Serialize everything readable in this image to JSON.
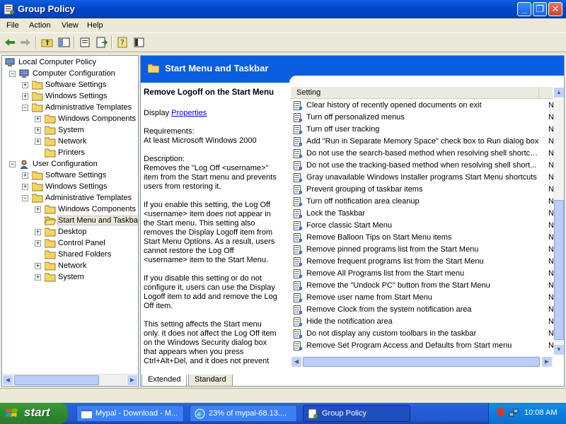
{
  "window": {
    "title": "Group Policy",
    "buttons": {
      "minimize": "_",
      "maximize": "❐",
      "close": "✕"
    }
  },
  "menubar": [
    "File",
    "Action",
    "View",
    "Help"
  ],
  "tree": {
    "items": [
      {
        "label": "Local Computer Policy",
        "indent": 0,
        "expander": "",
        "icon": "computer-policy-icon"
      },
      {
        "label": "Computer Configuration",
        "indent": 1,
        "expander": "−",
        "icon": "computer-icon"
      },
      {
        "label": "Software Settings",
        "indent": 2,
        "expander": "+",
        "icon": "folder-icon"
      },
      {
        "label": "Windows Settings",
        "indent": 2,
        "expander": "+",
        "icon": "folder-icon"
      },
      {
        "label": "Administrative Templates",
        "indent": 2,
        "expander": "−",
        "icon": "folder-icon"
      },
      {
        "label": "Windows Components",
        "indent": 3,
        "expander": "+",
        "icon": "folder-icon"
      },
      {
        "label": "System",
        "indent": 3,
        "expander": "+",
        "icon": "folder-icon"
      },
      {
        "label": "Network",
        "indent": 3,
        "expander": "+",
        "icon": "folder-icon"
      },
      {
        "label": "Printers",
        "indent": 3,
        "expander": "",
        "icon": "folder-icon"
      },
      {
        "label": "User Configuration",
        "indent": 1,
        "expander": "−",
        "icon": "user-icon"
      },
      {
        "label": "Software Settings",
        "indent": 2,
        "expander": "+",
        "icon": "folder-icon"
      },
      {
        "label": "Windows Settings",
        "indent": 2,
        "expander": "+",
        "icon": "folder-icon"
      },
      {
        "label": "Administrative Templates",
        "indent": 2,
        "expander": "−",
        "icon": "folder-icon"
      },
      {
        "label": "Windows Components",
        "indent": 3,
        "expander": "+",
        "icon": "folder-icon"
      },
      {
        "label": "Start Menu and Taskbar",
        "indent": 3,
        "expander": "",
        "icon": "open-folder-icon",
        "selected": true
      },
      {
        "label": "Desktop",
        "indent": 3,
        "expander": "+",
        "icon": "folder-icon"
      },
      {
        "label": "Control Panel",
        "indent": 3,
        "expander": "+",
        "icon": "folder-icon"
      },
      {
        "label": "Shared Folders",
        "indent": 3,
        "expander": "",
        "icon": "folder-icon"
      },
      {
        "label": "Network",
        "indent": 3,
        "expander": "+",
        "icon": "folder-icon"
      },
      {
        "label": "System",
        "indent": 3,
        "expander": "+",
        "icon": "folder-icon"
      }
    ]
  },
  "banner": {
    "title": "Start Menu and Taskbar"
  },
  "description": {
    "heading": "Remove Logoff on the Start Menu",
    "display_prefix": "Display ",
    "display_link": "Properties",
    "requirements_label": "Requirements:",
    "requirements_value": "At least Microsoft Windows 2000",
    "description_label": "Description:",
    "p1": "Removes the \"Log Off <username>\" item from the Start menu and prevents users from restoring it.",
    "p2": "If you enable this setting, the Log Off <username> item does not appear in the Start menu. This setting also removes the Display Logoff item from Start Menu Options. As a result, users cannot restore the Log Off <username> item to the Start Menu.",
    "p3": "If you disable this setting or do not configure it, users can use the Display Logoff item to add and remove the Log Off item.",
    "p4": "This setting affects the Start menu only. It does not affect the Log Off item on the Windows Security dialog box that appears when you press Ctrl+Alt+Del, and it does not prevent users from using other methods to log off."
  },
  "list": {
    "header": "Setting",
    "rows": [
      {
        "name": "Clear history of recently opened documents on exit",
        "state": "N"
      },
      {
        "name": "Turn off personalized menus",
        "state": "N"
      },
      {
        "name": "Turn off user tracking",
        "state": "N"
      },
      {
        "name": "Add \"Run in Separate Memory Space\" check box to Run dialog box",
        "state": "N"
      },
      {
        "name": "Do not use the search-based method when resolving shell shortcuts",
        "state": "N"
      },
      {
        "name": "Do not use the tracking-based method when resolving shell short...",
        "state": "N"
      },
      {
        "name": "Gray unavailable Windows Installer programs Start Menu shortcuts",
        "state": "N"
      },
      {
        "name": "Prevent grouping of taskbar items",
        "state": "N"
      },
      {
        "name": "Turn off notification area cleanup",
        "state": "N"
      },
      {
        "name": "Lock the Taskbar",
        "state": "N"
      },
      {
        "name": "Force classic Start Menu",
        "state": "N"
      },
      {
        "name": "Remove Balloon Tips on Start Menu items",
        "state": "N"
      },
      {
        "name": "Remove pinned programs list from the Start Menu",
        "state": "N"
      },
      {
        "name": "Remove frequent programs list from the Start Menu",
        "state": "N"
      },
      {
        "name": "Remove All Programs list from the Start menu",
        "state": "N"
      },
      {
        "name": "Remove the \"Undock PC\" button from the Start Menu",
        "state": "N"
      },
      {
        "name": "Remove user name from Start Menu",
        "state": "N"
      },
      {
        "name": "Remove Clock from the system notification area",
        "state": "N"
      },
      {
        "name": "Hide the notification area",
        "state": "N"
      },
      {
        "name": "Do not display any custom toolbars in the taskbar",
        "state": "N"
      },
      {
        "name": "Remove Set Program Access and Defaults from Start menu",
        "state": "N"
      }
    ]
  },
  "tabs": [
    {
      "label": "Extended",
      "active": true
    },
    {
      "label": "Standard",
      "active": false
    }
  ],
  "taskbar": {
    "start_label": "start",
    "tasks": [
      {
        "label": "Mypal - Download - M...",
        "active": false,
        "icon": "mypal-icon"
      },
      {
        "label": "23% of mypal-68.13....",
        "active": false,
        "icon": "download-icon"
      },
      {
        "label": "Group Policy",
        "active": true,
        "icon": "group-policy-icon"
      }
    ],
    "clock": "10:08 AM"
  },
  "colors": {
    "titlebar": "#0348CC",
    "banner": "#0A5DE0",
    "taskbar": "#245EDB",
    "start": "#2F8A2F"
  }
}
